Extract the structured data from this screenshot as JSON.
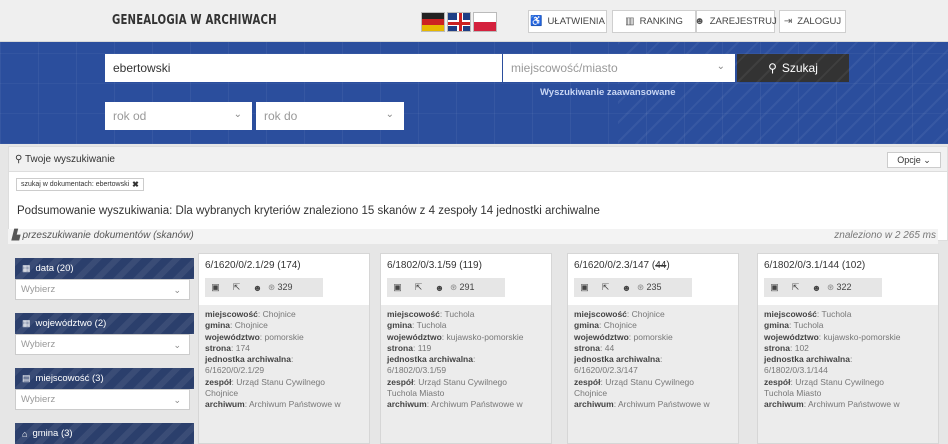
{
  "header": {
    "brand": "GENEALOGIA W ARCHIWACH",
    "flags": [
      "de-flag-icon",
      "gb-flag-icon",
      "pl-flag-icon"
    ],
    "buttons": [
      {
        "label": "UŁATWIENIA",
        "icon": "accessibility-icon"
      },
      {
        "label": "RANKING",
        "icon": "bar-chart-icon"
      },
      {
        "label": "ZAREJESTRUJ",
        "icon": "users-icon"
      },
      {
        "label": "ZALOGUJ",
        "icon": "login-icon"
      }
    ]
  },
  "search": {
    "query": "ebertowski",
    "place_placeholder": "miejscowość/miasto",
    "button_label": "Szukaj",
    "advanced_link": "Wyszukiwanie zaawansowane",
    "year_from": "rok od",
    "year_to": "rok do"
  },
  "results": {
    "your_search": "Twoje wyszukiwanie",
    "options": "Opcje",
    "tag": "szukaj w dokumentach: ebertowski",
    "summary": "Podsumowanie wyszukiwania: Dla wybranych kryteriów znaleziono 15 skanów z 4 zespoły 14 jednostki archiwalne",
    "scan_search": "przeszukiwanie dokumentów (skanów)",
    "found_in": "znaleziono w 2 265 ms"
  },
  "filters": [
    {
      "label": "data (20)",
      "icon": "calendar-icon",
      "select": "Wybierz"
    },
    {
      "label": "województwo (2)",
      "icon": "building-icon",
      "select": "Wybierz"
    },
    {
      "label": "miejscowość (3)",
      "icon": "map-icon",
      "select": "Wybierz"
    },
    {
      "label": "gmina (3)",
      "icon": "home-icon",
      "select": ""
    }
  ],
  "labels": {
    "miejscowosc": "miejscowość",
    "gmina": "gmina",
    "wojewodztwo": "województwo",
    "strona": "strona",
    "jednostka": "jednostka archiwalna",
    "zespol": "zespół",
    "archiwum": "archiwum"
  },
  "cards": [
    {
      "sig_main": "6/1620/0/2.1/29 ",
      "sig_paren": "(174)",
      "sig_strike": "",
      "count": "329",
      "miejscowosc": "Chojnice",
      "gmina": "Chojnice",
      "wojewodztwo": "pomorskie",
      "strona": "174",
      "jednostka": "6/1620/0/2.1/29",
      "zespol": "Urząd Stanu Cywilnego",
      "zespol2": "Chojnice",
      "archiwum": "Archiwum Państwowe w"
    },
    {
      "sig_main": "6/1802/0/3.1/59 ",
      "sig_paren": "(119)",
      "sig_strike": "",
      "count": "291",
      "miejscowosc": "Tuchola",
      "gmina": "Tuchola",
      "wojewodztwo": "kujawsko-pomorskie",
      "strona": "119",
      "jednostka": "6/1802/0/3.1/59",
      "zespol": "Urząd Stanu Cywilnego",
      "zespol2": "Tuchola Miasto",
      "archiwum": "Archiwum Państwowe w"
    },
    {
      "sig_main": "6/1620/0/2.3/147 (",
      "sig_paren": ")",
      "sig_strike": "44",
      "count": "235",
      "miejscowosc": "Chojnice",
      "gmina": "Chojnice",
      "wojewodztwo": "pomorskie",
      "strona": "44",
      "jednostka": "6/1620/0/2.3/147",
      "zespol": "Urząd Stanu Cywilnego",
      "zespol2": "Chojnice",
      "archiwum": "Archiwum Państwowe w"
    },
    {
      "sig_main": "6/1802/0/3.1/144 ",
      "sig_paren": "(102)",
      "sig_strike": "",
      "count": "322",
      "miejscowosc": "Tuchola",
      "gmina": "Tuchola",
      "wojewodztwo": "kujawsko-pomorskie",
      "strona": "102",
      "jednostka": "6/1802/0/3.1/144",
      "zespol": "Urząd Stanu Cywilnego",
      "zespol2": "Tuchola Miasto",
      "archiwum": "Archiwum Państwowe w"
    }
  ],
  "colors": {
    "hero": "#2b4e9d",
    "filter_head": "#2b3f6c",
    "search_button": "#333333"
  }
}
